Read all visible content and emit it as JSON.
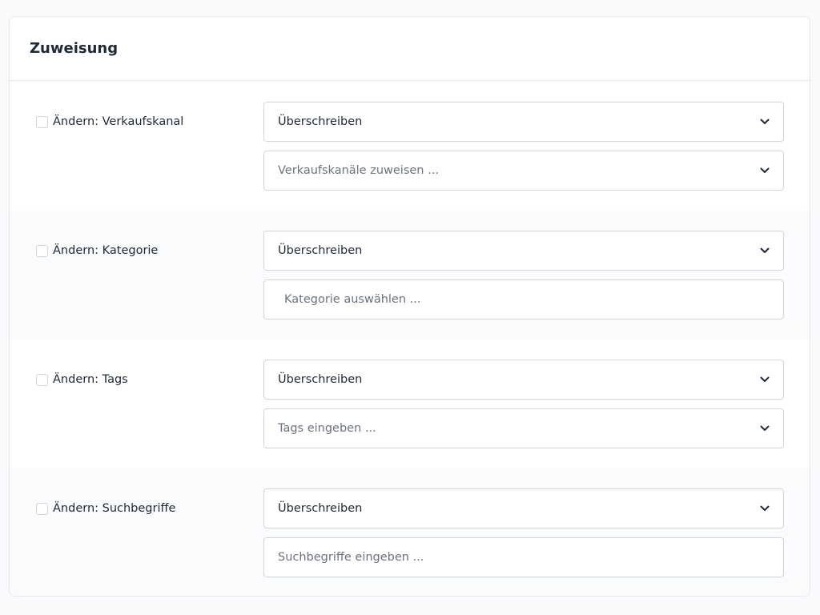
{
  "card": {
    "title": "Zuweisung"
  },
  "sections": [
    {
      "label": "Ändern: Verkaufskanal",
      "mode": "Überschreiben",
      "input_placeholder": "Verkaufskanäle zuweisen ..."
    },
    {
      "label": "Ändern: Kategorie",
      "mode": "Überschreiben",
      "input_placeholder": "Kategorie auswählen ..."
    },
    {
      "label": "Ändern: Tags",
      "mode": "Überschreiben",
      "input_placeholder": "Tags eingeben ..."
    },
    {
      "label": "Ändern: Suchbegriffe",
      "mode": "Überschreiben",
      "input_placeholder": "Suchbegriffe eingeben ..."
    }
  ],
  "icons": {
    "dropdown": "chevron-down-icon"
  }
}
